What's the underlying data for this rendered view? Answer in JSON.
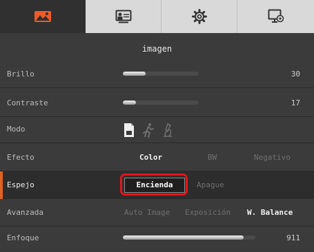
{
  "tabs": [
    {
      "icon": "image-icon",
      "active": true
    },
    {
      "icon": "presenter-icon",
      "active": false
    },
    {
      "icon": "gear-icon",
      "active": false
    },
    {
      "icon": "monitor-settings-icon",
      "active": false
    }
  ],
  "menu": {
    "title": "imagen",
    "brightness": {
      "label": "Brillo",
      "value": "30",
      "level": 0.3
    },
    "contrast": {
      "label": "Contraste",
      "value": "17",
      "level": 0.17
    },
    "mode": {
      "label": "Modo",
      "icons": [
        "document-icon",
        "motion-icon",
        "microscope-icon"
      ]
    },
    "effect": {
      "label": "Efecto",
      "options": [
        "Color",
        "BW",
        "Negativo"
      ],
      "selected": "Color"
    },
    "mirror": {
      "label": "Espejo",
      "on_label": "Encienda",
      "off_label": "Apague",
      "selected": "Encienda"
    },
    "advanced": {
      "label": "Avanzada",
      "options": [
        "Auto Image",
        "Exposición",
        "W. Balance"
      ],
      "selected": "W. Balance"
    },
    "focus": {
      "label": "Enfoque",
      "value": "911",
      "level": 0.911
    }
  },
  "colors": {
    "accent": "#e0621c",
    "highlight": "#e2161d",
    "tab_active_icon": "#f05a28"
  }
}
